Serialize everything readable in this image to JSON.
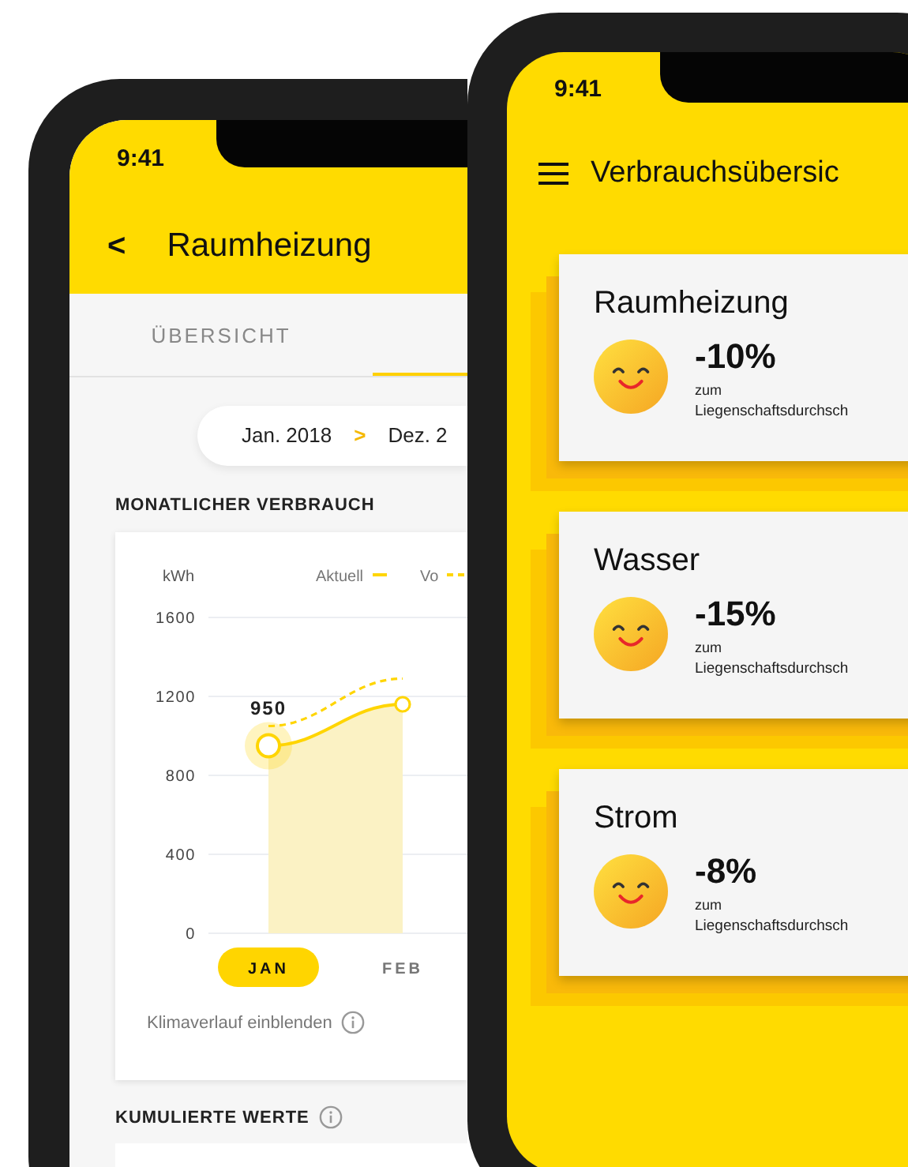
{
  "left_phone": {
    "status_time": "9:41",
    "back_icon": "<",
    "title": "Raumheizung",
    "tabs": [
      {
        "label": "ÜBERSICHT",
        "selected": false
      },
      {
        "selected": true
      }
    ],
    "date_range": {
      "from": "Jan. 2018",
      "separator": ">",
      "to": "Dez. 2"
    },
    "section_title": "MONATLICHER VERBRAUCH",
    "chart": {
      "unit": "kWh",
      "highlight_label": "950",
      "chart_data": {
        "type": "line",
        "categories": [
          "JAN",
          "FEB"
        ],
        "yticks": [
          0,
          400,
          800,
          1200,
          1600
        ],
        "ylim": [
          0,
          1600
        ],
        "grid": true,
        "legend": "top right",
        "series": [
          {
            "name": "Aktuell",
            "type": "area",
            "color": "#ffd500",
            "line_style": "solid",
            "values": [
              950,
              1160
            ]
          },
          {
            "name": "Vo",
            "color": "#ffd500",
            "line_style": "dashed",
            "values": [
              1050,
              1290
            ]
          }
        ]
      },
      "month_tabs": [
        {
          "selected": true
        },
        {
          "selected": false
        }
      ],
      "toggle_label": "Klimaverlauf einblenden"
    },
    "cumulative_title": "KUMULIERTE WERTE"
  },
  "right_phone": {
    "status_time": "9:41",
    "title": "Verbrauchsübersic",
    "cards": [
      {
        "title": "Raumheizung",
        "percent": "-10%",
        "note_line1": "zum",
        "note_line2": "Liegenschaftsdurchsch"
      },
      {
        "title": "Wasser",
        "percent": "-15%",
        "note_line1": "zum",
        "note_line2": "Liegenschaftsdurchsch"
      },
      {
        "title": "Strom",
        "percent": "-8%",
        "note_line1": "zum",
        "note_line2": "Liegenschaftsdurchsch"
      }
    ]
  }
}
